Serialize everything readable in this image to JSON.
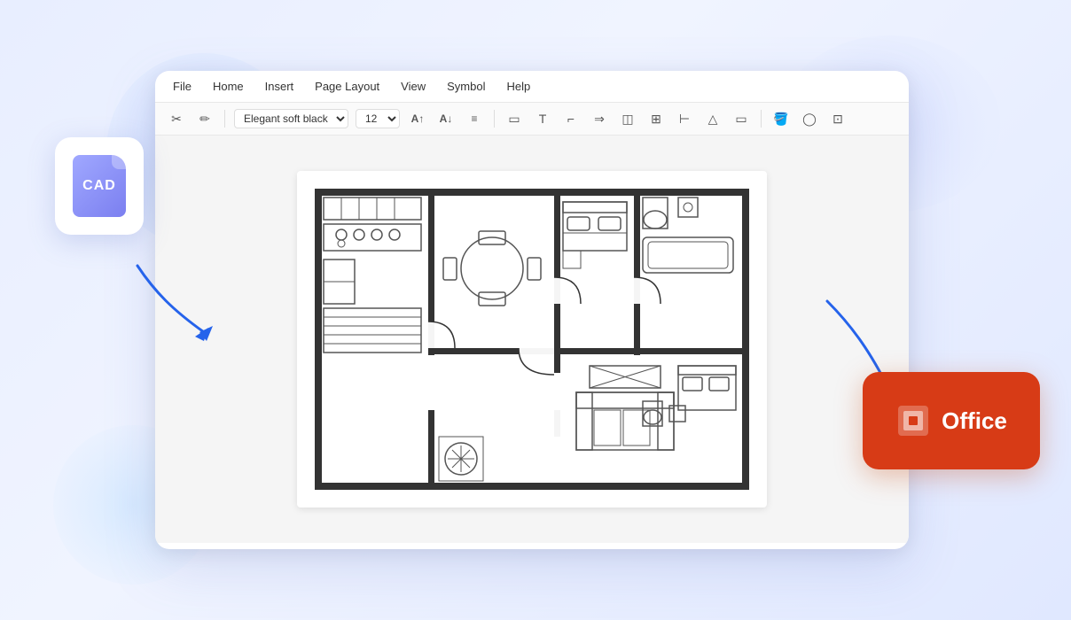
{
  "background": {
    "color": "#e8eeff"
  },
  "app_window": {
    "menu": {
      "items": [
        "File",
        "Home",
        "Insert",
        "Page Layout",
        "View",
        "Symbol",
        "Help"
      ]
    },
    "toolbar": {
      "font": "Elegant soft black",
      "size": "12",
      "tools": [
        "scissors",
        "pen",
        "text",
        "font-up",
        "font-down",
        "align",
        "rect",
        "T",
        "corner",
        "arrow",
        "layers",
        "table",
        "ruler",
        "mountain",
        "page",
        "fill",
        "circle",
        "crop"
      ]
    }
  },
  "cad_icon": {
    "label": "CAD"
  },
  "office_icon": {
    "label": "Office"
  }
}
